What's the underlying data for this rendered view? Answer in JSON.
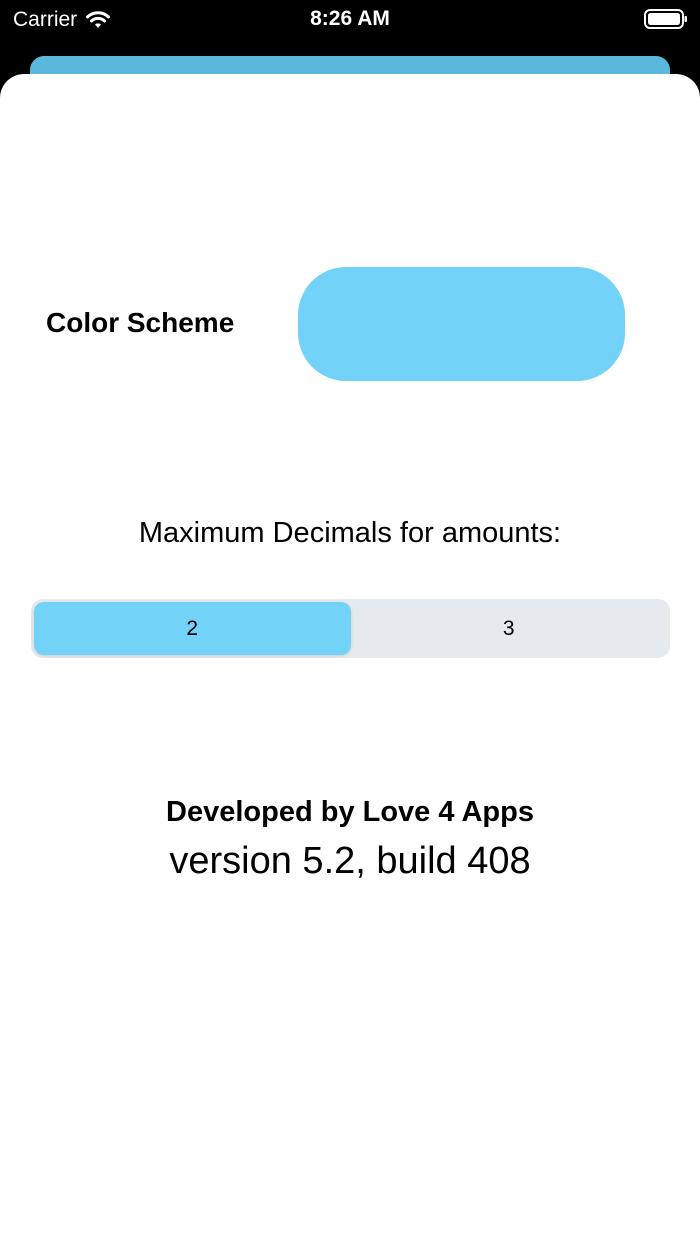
{
  "status_bar": {
    "carrier": "Carrier",
    "time": "8:26 AM",
    "wifi_icon": "wifi-icon",
    "battery_icon": "battery-icon"
  },
  "settings": {
    "color_scheme_label": "Color Scheme",
    "color_scheme_value_color": "#72d2f8",
    "decimals_label": "Maximum Decimals for amounts:",
    "decimal_options": [
      "2",
      "3"
    ],
    "decimal_selected": "2",
    "developer": "Developed by Love 4 Apps",
    "version": "version 5.2, build 408"
  },
  "colors": {
    "accent": "#72d2f8",
    "segment_bg": "#e5eaef",
    "back_card": "#5ab8dc"
  }
}
